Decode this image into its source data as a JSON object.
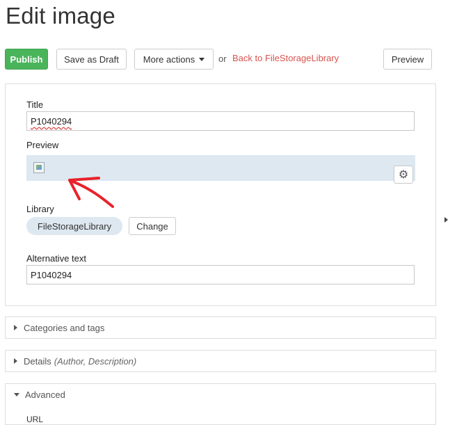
{
  "page": {
    "title": "Edit image"
  },
  "toolbar": {
    "publish_label": "Publish",
    "save_draft_label": "Save as Draft",
    "more_actions_label": "More actions",
    "or_text": "or",
    "back_link_label": "Back to FileStorageLibrary",
    "preview_label": "Preview"
  },
  "form": {
    "title_label": "Title",
    "title_value": "P1040294",
    "preview_label": "Preview",
    "library_label": "Library",
    "library_value": "FileStorageLibrary",
    "change_label": "Change",
    "alt_label": "Alternative text",
    "alt_value": "P1040294"
  },
  "sections": {
    "categories_label": "Categories and tags",
    "details_label": "Details",
    "details_hint": "(Author, Description)",
    "advanced_label": "Advanced",
    "advanced_first_label": "URL"
  },
  "colors": {
    "primary": "#4ab45a",
    "link": "#d9534f",
    "annotation_arrow": "#e8222b",
    "preview_bg": "#dde8f1"
  },
  "icons": {
    "gear": "gear-icon",
    "broken_image": "broken-image-icon",
    "caret": "chevron-down-icon"
  }
}
